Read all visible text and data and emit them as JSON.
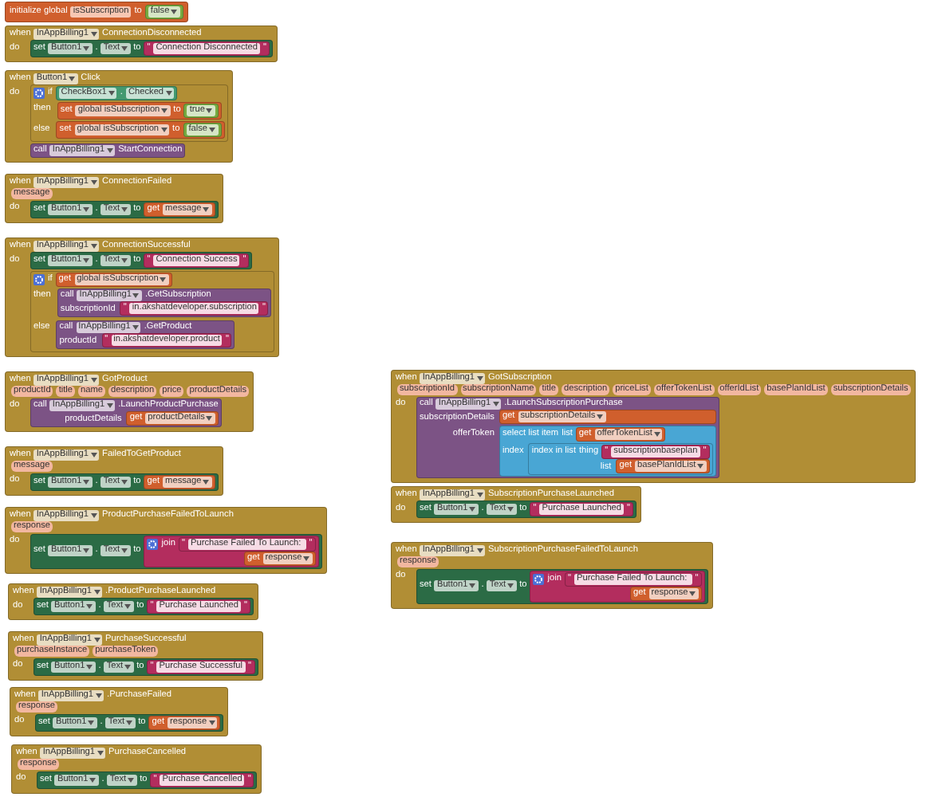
{
  "blocks": [
    {
      "kind": "variable",
      "head": [
        {
          "kind": "label",
          "text": "initialize global"
        },
        {
          "kind": "field",
          "text": "isSubscription"
        },
        {
          "kind": "label",
          "text": "to"
        }
      ],
      "inline": {
        "kind": "logic",
        "head": [
          {
            "kind": "dropdown",
            "text": "false"
          }
        ]
      }
    },
    {
      "kind": "event",
      "head": [
        {
          "kind": "label",
          "text": "when"
        },
        {
          "kind": "dropdown",
          "text": "InAppBilling1"
        },
        {
          "kind": "label",
          "text": "ConnectionDisconnected"
        }
      ],
      "sections": [
        {
          "label": "do",
          "body": [
            {
              "kind": "set_property",
              "head": [
                {
                  "kind": "label",
                  "text": "set"
                },
                {
                  "kind": "dropdown",
                  "text": "Button1"
                },
                {
                  "kind": "label",
                  "text": "."
                },
                {
                  "kind": "dropdown",
                  "text": "Text"
                },
                {
                  "kind": "label",
                  "text": "to"
                }
              ],
              "inline": {
                "kind": "text",
                "head": [
                  {
                    "kind": "quote",
                    "text": "\""
                  },
                  {
                    "kind": "field",
                    "text": "Connection Disconnected"
                  },
                  {
                    "kind": "quote",
                    "text": "\""
                  }
                ]
              }
            }
          ]
        }
      ]
    },
    {
      "kind": "event",
      "head": [
        {
          "kind": "label",
          "text": "when"
        },
        {
          "kind": "dropdown",
          "text": "Button1"
        },
        {
          "kind": "label",
          "text": "Click"
        }
      ],
      "sections": [
        {
          "label": "do",
          "body": [
            {
              "kind": "control",
              "head": [
                {
                  "kind": "gear"
                },
                {
                  "kind": "label",
                  "text": "if"
                }
              ],
              "inline": {
                "kind": "component",
                "head": [
                  {
                    "kind": "dropdown",
                    "text": "CheckBox1"
                  },
                  {
                    "kind": "label",
                    "text": "."
                  },
                  {
                    "kind": "dropdown",
                    "text": "Checked"
                  }
                ]
              },
              "sections": [
                {
                  "label": "then",
                  "body": [
                    {
                      "kind": "variable",
                      "head": [
                        {
                          "kind": "label",
                          "text": "set"
                        },
                        {
                          "kind": "dropdown",
                          "text": "global isSubscription"
                        },
                        {
                          "kind": "label",
                          "text": "to"
                        }
                      ],
                      "inline": {
                        "kind": "logic",
                        "head": [
                          {
                            "kind": "dropdown",
                            "text": "true"
                          }
                        ]
                      }
                    }
                  ]
                },
                {
                  "label": "else",
                  "body": [
                    {
                      "kind": "variable",
                      "head": [
                        {
                          "kind": "label",
                          "text": "set"
                        },
                        {
                          "kind": "dropdown",
                          "text": "global isSubscription"
                        },
                        {
                          "kind": "label",
                          "text": "to"
                        }
                      ],
                      "inline": {
                        "kind": "logic",
                        "head": [
                          {
                            "kind": "dropdown",
                            "text": "false"
                          }
                        ]
                      }
                    }
                  ]
                }
              ]
            },
            {
              "kind": "call",
              "head": [
                {
                  "kind": "label",
                  "text": "call"
                },
                {
                  "kind": "dropdown",
                  "text": "InAppBilling1"
                },
                {
                  "kind": "label",
                  "text": "StartConnection"
                }
              ]
            }
          ]
        }
      ]
    },
    {
      "kind": "event",
      "head": [
        {
          "kind": "label",
          "text": "when"
        },
        {
          "kind": "dropdown",
          "text": "InAppBilling1"
        },
        {
          "kind": "label",
          "text": "ConnectionFailed"
        }
      ],
      "params": [
        "message"
      ],
      "sections": [
        {
          "label": "do",
          "body": [
            {
              "kind": "set_property",
              "head": [
                {
                  "kind": "label",
                  "text": "set"
                },
                {
                  "kind": "dropdown",
                  "text": "Button1"
                },
                {
                  "kind": "label",
                  "text": "."
                },
                {
                  "kind": "dropdown",
                  "text": "Text"
                },
                {
                  "kind": "label",
                  "text": "to"
                }
              ],
              "inline": {
                "kind": "variable",
                "head": [
                  {
                    "kind": "label",
                    "text": "get"
                  },
                  {
                    "kind": "dropdown",
                    "text": "message"
                  }
                ]
              }
            }
          ]
        }
      ]
    },
    {
      "kind": "event",
      "head": [
        {
          "kind": "label",
          "text": "when"
        },
        {
          "kind": "dropdown",
          "text": "InAppBilling1"
        },
        {
          "kind": "label",
          "text": "ConnectionSuccessful"
        }
      ],
      "sections": [
        {
          "label": "do",
          "body": [
            {
              "kind": "set_property",
              "head": [
                {
                  "kind": "label",
                  "text": "set"
                },
                {
                  "kind": "dropdown",
                  "text": "Button1"
                },
                {
                  "kind": "label",
                  "text": "."
                },
                {
                  "kind": "dropdown",
                  "text": "Text"
                },
                {
                  "kind": "label",
                  "text": "to"
                }
              ],
              "inline": {
                "kind": "text",
                "head": [
                  {
                    "kind": "quote",
                    "text": "\""
                  },
                  {
                    "kind": "field",
                    "text": "Connection Success"
                  },
                  {
                    "kind": "quote",
                    "text": "\""
                  }
                ]
              }
            },
            {
              "kind": "control",
              "head": [
                {
                  "kind": "gear"
                },
                {
                  "kind": "label",
                  "text": "if"
                }
              ],
              "inline": {
                "kind": "variable",
                "head": [
                  {
                    "kind": "label",
                    "text": "get"
                  },
                  {
                    "kind": "dropdown",
                    "text": "global isSubscription"
                  }
                ]
              },
              "sections": [
                {
                  "label": "then",
                  "body": [
                    {
                      "kind": "call",
                      "head": [
                        {
                          "kind": "label",
                          "text": "call"
                        },
                        {
                          "kind": "dropdown",
                          "text": "InAppBilling1"
                        },
                        {
                          "kind": "label",
                          "text": ".GetSubscription"
                        }
                      ],
                      "inputs": [
                        {
                          "label": "subscriptionId",
                          "value": {
                            "kind": "text",
                            "head": [
                              {
                                "kind": "quote",
                                "text": "\""
                              },
                              {
                                "kind": "field",
                                "text": "in.akshatdeveloper.subscription"
                              },
                              {
                                "kind": "quote",
                                "text": "\""
                              }
                            ]
                          }
                        }
                      ]
                    }
                  ]
                },
                {
                  "label": "else",
                  "body": [
                    {
                      "kind": "call",
                      "head": [
                        {
                          "kind": "label",
                          "text": "call"
                        },
                        {
                          "kind": "dropdown",
                          "text": "InAppBilling1"
                        },
                        {
                          "kind": "label",
                          "text": ".GetProduct"
                        }
                      ],
                      "inputs": [
                        {
                          "label": "productId",
                          "value": {
                            "kind": "text",
                            "head": [
                              {
                                "kind": "quote",
                                "text": "\""
                              },
                              {
                                "kind": "field",
                                "text": "in.akshatdeveloper.product"
                              },
                              {
                                "kind": "quote",
                                "text": "\""
                              }
                            ]
                          }
                        }
                      ]
                    }
                  ]
                }
              ]
            }
          ]
        }
      ]
    },
    {
      "kind": "event",
      "head": [
        {
          "kind": "label",
          "text": "when"
        },
        {
          "kind": "dropdown",
          "text": "InAppBilling1"
        },
        {
          "kind": "label",
          "text": "GotProduct"
        }
      ],
      "params": [
        "productId",
        "title",
        "name",
        "description",
        "price",
        "productDetails"
      ],
      "sections": [
        {
          "label": "do",
          "body": [
            {
              "kind": "call",
              "head": [
                {
                  "kind": "label",
                  "text": "call"
                },
                {
                  "kind": "dropdown",
                  "text": "InAppBilling1"
                },
                {
                  "kind": "label",
                  "text": ".LaunchProductPurchase"
                }
              ],
              "inputs": [
                {
                  "label": "productDetails",
                  "value": {
                    "kind": "variable",
                    "head": [
                      {
                        "kind": "label",
                        "text": "get"
                      },
                      {
                        "kind": "dropdown",
                        "text": "productDetails"
                      }
                    ]
                  }
                }
              ]
            }
          ]
        }
      ]
    },
    {
      "kind": "event",
      "head": [
        {
          "kind": "label",
          "text": "when"
        },
        {
          "kind": "dropdown",
          "text": "InAppBilling1"
        },
        {
          "kind": "label",
          "text": "FailedToGetProduct"
        }
      ],
      "params": [
        "message"
      ],
      "sections": [
        {
          "label": "do",
          "body": [
            {
              "kind": "set_property",
              "head": [
                {
                  "kind": "label",
                  "text": "set"
                },
                {
                  "kind": "dropdown",
                  "text": "Button1"
                },
                {
                  "kind": "label",
                  "text": "."
                },
                {
                  "kind": "dropdown",
                  "text": "Text"
                },
                {
                  "kind": "label",
                  "text": "to"
                }
              ],
              "inline": {
                "kind": "variable",
                "head": [
                  {
                    "kind": "label",
                    "text": "get"
                  },
                  {
                    "kind": "dropdown",
                    "text": "message"
                  }
                ]
              }
            }
          ]
        }
      ]
    },
    {
      "kind": "event",
      "head": [
        {
          "kind": "label",
          "text": "when"
        },
        {
          "kind": "dropdown",
          "text": "InAppBilling1"
        },
        {
          "kind": "label",
          "text": "ProductPurchaseFailedToLaunch"
        }
      ],
      "params": [
        "response"
      ],
      "sections": [
        {
          "label": "do",
          "body": [
            {
              "kind": "set_property",
              "head": [
                {
                  "kind": "label",
                  "text": "set"
                },
                {
                  "kind": "dropdown",
                  "text": "Button1"
                },
                {
                  "kind": "label",
                  "text": "."
                },
                {
                  "kind": "dropdown",
                  "text": "Text"
                },
                {
                  "kind": "label",
                  "text": "to"
                }
              ],
              "inline": {
                "kind": "text",
                "head": [
                  {
                    "kind": "gear"
                  },
                  {
                    "kind": "label",
                    "text": "join"
                  }
                ],
                "inline": {
                  "kind": "text",
                  "head": [
                    {
                      "kind": "quote",
                      "text": "\""
                    },
                    {
                      "kind": "field",
                      "text": "Purchase Failed To Launch: "
                    },
                    {
                      "kind": "quote",
                      "text": "\""
                    }
                  ]
                },
                "inputs": [
                  {
                    "value": {
                      "kind": "variable",
                      "head": [
                        {
                          "kind": "label",
                          "text": "get"
                        },
                        {
                          "kind": "dropdown",
                          "text": "response"
                        }
                      ]
                    }
                  }
                ]
              }
            }
          ]
        }
      ]
    },
    {
      "kind": "event",
      "head": [
        {
          "kind": "label",
          "text": "when"
        },
        {
          "kind": "dropdown",
          "text": "InAppBilling1"
        },
        {
          "kind": "label",
          "text": ".ProductPurchaseLaunched"
        }
      ],
      "sections": [
        {
          "label": "do",
          "body": [
            {
              "kind": "set_property",
              "head": [
                {
                  "kind": "label",
                  "text": "set"
                },
                {
                  "kind": "dropdown",
                  "text": "Button1"
                },
                {
                  "kind": "label",
                  "text": "."
                },
                {
                  "kind": "dropdown",
                  "text": "Text"
                },
                {
                  "kind": "label",
                  "text": "to"
                }
              ],
              "inline": {
                "kind": "text",
                "head": [
                  {
                    "kind": "quote",
                    "text": "\""
                  },
                  {
                    "kind": "field",
                    "text": "Purchase Launched"
                  },
                  {
                    "kind": "quote",
                    "text": "\""
                  }
                ]
              }
            }
          ]
        }
      ]
    },
    {
      "kind": "event",
      "head": [
        {
          "kind": "label",
          "text": "when"
        },
        {
          "kind": "dropdown",
          "text": "InAppBilling1"
        },
        {
          "kind": "label",
          "text": "PurchaseSuccessful"
        }
      ],
      "params": [
        "purchaseInstance",
        "purchaseToken"
      ],
      "sections": [
        {
          "label": "do",
          "body": [
            {
              "kind": "set_property",
              "head": [
                {
                  "kind": "label",
                  "text": "set"
                },
                {
                  "kind": "dropdown",
                  "text": "Button1"
                },
                {
                  "kind": "label",
                  "text": "."
                },
                {
                  "kind": "dropdown",
                  "text": "Text"
                },
                {
                  "kind": "label",
                  "text": "to"
                }
              ],
              "inline": {
                "kind": "text",
                "head": [
                  {
                    "kind": "quote",
                    "text": "\""
                  },
                  {
                    "kind": "field",
                    "text": "Purchase Successful"
                  },
                  {
                    "kind": "quote",
                    "text": "\""
                  }
                ]
              }
            }
          ]
        }
      ]
    },
    {
      "kind": "event",
      "head": [
        {
          "kind": "label",
          "text": "when"
        },
        {
          "kind": "dropdown",
          "text": "InAppBilling1"
        },
        {
          "kind": "label",
          "text": ".PurchaseFailed"
        }
      ],
      "params": [
        "response"
      ],
      "sections": [
        {
          "label": "do",
          "body": [
            {
              "kind": "set_property",
              "head": [
                {
                  "kind": "label",
                  "text": "set"
                },
                {
                  "kind": "dropdown",
                  "text": "Button1"
                },
                {
                  "kind": "label",
                  "text": "."
                },
                {
                  "kind": "dropdown",
                  "text": "Text"
                },
                {
                  "kind": "label",
                  "text": "to"
                }
              ],
              "inline": {
                "kind": "variable",
                "head": [
                  {
                    "kind": "label",
                    "text": "get"
                  },
                  {
                    "kind": "dropdown",
                    "text": "response"
                  }
                ]
              }
            }
          ]
        }
      ]
    },
    {
      "kind": "event",
      "head": [
        {
          "kind": "label",
          "text": "when"
        },
        {
          "kind": "dropdown",
          "text": "InAppBilling1"
        },
        {
          "kind": "label",
          "text": "PurchaseCancelled"
        }
      ],
      "params": [
        "response"
      ],
      "sections": [
        {
          "label": "do",
          "body": [
            {
              "kind": "set_property",
              "head": [
                {
                  "kind": "label",
                  "text": "set"
                },
                {
                  "kind": "dropdown",
                  "text": "Button1"
                },
                {
                  "kind": "label",
                  "text": "."
                },
                {
                  "kind": "dropdown",
                  "text": "Text"
                },
                {
                  "kind": "label",
                  "text": "to"
                }
              ],
              "inline": {
                "kind": "text",
                "head": [
                  {
                    "kind": "quote",
                    "text": "\""
                  },
                  {
                    "kind": "field",
                    "text": "Purchase Cancelled"
                  },
                  {
                    "kind": "quote",
                    "text": "\""
                  }
                ]
              }
            }
          ]
        }
      ]
    },
    {
      "kind": "event",
      "head": [
        {
          "kind": "label",
          "text": "when"
        },
        {
          "kind": "dropdown",
          "text": "InAppBilling1"
        },
        {
          "kind": "label",
          "text": "GotSubscription"
        }
      ],
      "params": [
        "subscriptionId",
        "subscriptionName",
        "title",
        "description",
        "priceList",
        "offerTokenList",
        "offerIdList",
        "basePlanIdList",
        "subscriptionDetails"
      ],
      "sections": [
        {
          "label": "do",
          "body": [
            {
              "kind": "call",
              "head": [
                {
                  "kind": "label",
                  "text": "call"
                },
                {
                  "kind": "dropdown",
                  "text": "InAppBilling1"
                },
                {
                  "kind": "label",
                  "text": ".LaunchSubscriptionPurchase"
                }
              ],
              "inputs": [
                {
                  "label": "subscriptionDetails",
                  "value": {
                    "kind": "variable",
                    "head": [
                      {
                        "kind": "label",
                        "text": "get"
                      },
                      {
                        "kind": "dropdown",
                        "text": "subscriptionDetails"
                      }
                    ]
                  }
                },
                {
                  "label": "offerToken",
                  "value": {
                    "kind": "list",
                    "head": [
                      {
                        "kind": "label",
                        "text": "select list item"
                      },
                      {
                        "kind": "label",
                        "text": "list"
                      }
                    ],
                    "inline": {
                      "kind": "variable",
                      "head": [
                        {
                          "kind": "label",
                          "text": "get"
                        },
                        {
                          "kind": "dropdown",
                          "text": "offerTokenList"
                        }
                      ]
                    },
                    "inputs": [
                      {
                        "label": "index",
                        "value": {
                          "kind": "list",
                          "head": [
                            {
                              "kind": "label",
                              "text": "index in list"
                            },
                            {
                              "kind": "label",
                              "text": "thing"
                            }
                          ],
                          "inline": {
                            "kind": "text",
                            "head": [
                              {
                                "kind": "quote",
                                "text": "\""
                              },
                              {
                                "kind": "field",
                                "text": "subscriptionbaseplan"
                              },
                              {
                                "kind": "quote",
                                "text": "\""
                              }
                            ]
                          },
                          "inputs": [
                            {
                              "label": "list",
                              "value": {
                                "kind": "variable",
                                "head": [
                                  {
                                    "kind": "label",
                                    "text": "get"
                                  },
                                  {
                                    "kind": "dropdown",
                                    "text": "basePlanIdList"
                                  }
                                ]
                              }
                            }
                          ]
                        }
                      }
                    ]
                  }
                }
              ]
            }
          ]
        }
      ]
    },
    {
      "kind": "event",
      "head": [
        {
          "kind": "label",
          "text": "when"
        },
        {
          "kind": "dropdown",
          "text": "InAppBilling1"
        },
        {
          "kind": "label",
          "text": "SubscriptionPurchaseLaunched"
        }
      ],
      "sections": [
        {
          "label": "do",
          "body": [
            {
              "kind": "set_property",
              "head": [
                {
                  "kind": "label",
                  "text": "set"
                },
                {
                  "kind": "dropdown",
                  "text": "Button1"
                },
                {
                  "kind": "label",
                  "text": "."
                },
                {
                  "kind": "dropdown",
                  "text": "Text"
                },
                {
                  "kind": "label",
                  "text": "to"
                }
              ],
              "inline": {
                "kind": "text",
                "head": [
                  {
                    "kind": "quote",
                    "text": "\""
                  },
                  {
                    "kind": "field",
                    "text": "Purchase Launched"
                  },
                  {
                    "kind": "quote",
                    "text": "\""
                  }
                ]
              }
            }
          ]
        }
      ]
    },
    {
      "kind": "event",
      "head": [
        {
          "kind": "label",
          "text": "when"
        },
        {
          "kind": "dropdown",
          "text": "InAppBilling1"
        },
        {
          "kind": "label",
          "text": "SubscriptionPurchaseFailedToLaunch"
        }
      ],
      "params": [
        "response"
      ],
      "sections": [
        {
          "label": "do",
          "body": [
            {
              "kind": "set_property",
              "head": [
                {
                  "kind": "label",
                  "text": "set"
                },
                {
                  "kind": "dropdown",
                  "text": "Button1"
                },
                {
                  "kind": "label",
                  "text": "."
                },
                {
                  "kind": "dropdown",
                  "text": "Text"
                },
                {
                  "kind": "label",
                  "text": "to"
                }
              ],
              "inline": {
                "kind": "text",
                "head": [
                  {
                    "kind": "gear"
                  },
                  {
                    "kind": "label",
                    "text": "join"
                  }
                ],
                "inline": {
                  "kind": "text",
                  "head": [
                    {
                      "kind": "quote",
                      "text": "\""
                    },
                    {
                      "kind": "field",
                      "text": "Purchase Failed To Launch: "
                    },
                    {
                      "kind": "quote",
                      "text": "\""
                    }
                  ]
                },
                "inputs": [
                  {
                    "value": {
                      "kind": "variable",
                      "head": [
                        {
                          "kind": "label",
                          "text": "get"
                        },
                        {
                          "kind": "dropdown",
                          "text": "response"
                        }
                      ]
                    }
                  }
                ]
              }
            }
          ]
        }
      ]
    }
  ]
}
